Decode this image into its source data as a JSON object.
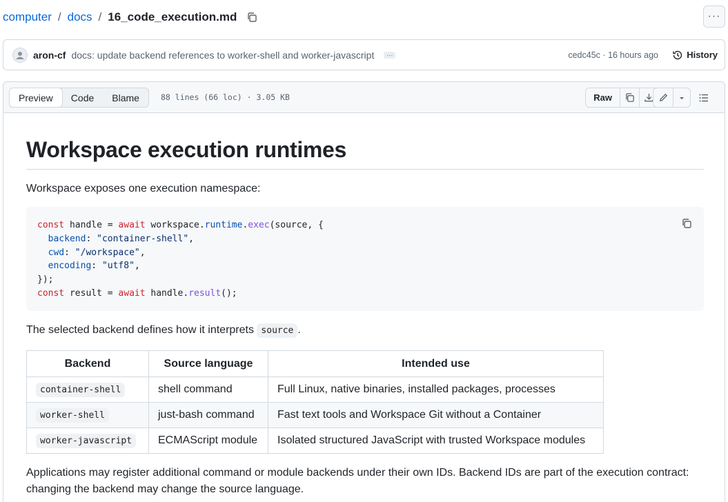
{
  "breadcrumb": {
    "repo": "computer",
    "folder": "docs",
    "file": "16_code_execution.md",
    "separator": "/"
  },
  "more_button": {
    "label": "···",
    "icon": "kebab-horizontal-icon"
  },
  "commit": {
    "author": "aron-cf",
    "message": "docs: update backend references to worker-shell and worker-javascript",
    "sha_time": "cedc45c · 16 hours ago",
    "history_label": "History"
  },
  "file_header": {
    "tabs": [
      "Preview",
      "Code",
      "Blame"
    ],
    "active_tab": "Preview",
    "meta": "88 lines (66 loc) · 3.05 KB",
    "raw_label": "Raw"
  },
  "content": {
    "title": "Workspace execution runtimes",
    "intro": "Workspace exposes one execution namespace:",
    "code_lines": [
      "const handle = await workspace.runtime.exec(source, {",
      "  backend: \"container-shell\",",
      "  cwd: \"/workspace\",",
      "  encoding: \"utf8\",",
      "});",
      "const result = await handle.result();"
    ],
    "selected_text_before": "The selected backend defines how it interprets ",
    "selected_code": "source",
    "selected_text_after": ".",
    "table": {
      "headers": [
        "Backend",
        "Source language",
        "Intended use"
      ],
      "rows": [
        [
          "container-shell",
          "shell command",
          "Full Linux, native binaries, installed packages, processes"
        ],
        [
          "worker-shell",
          "just-bash command",
          "Fast text tools and Workspace Git without a Container"
        ],
        [
          "worker-javascript",
          "ECMAScript module",
          "Isolated structured JavaScript with trusted Workspace modules"
        ]
      ]
    },
    "closing_line1": "Applications may register additional command or module backends under their own IDs. Backend IDs are part of the execution contract:",
    "closing_line2": "changing the backend may change the source language."
  },
  "colors": {
    "link": "#0969da",
    "border": "#d1d9e0",
    "muted": "#59636e",
    "keyword": "#cf222e",
    "function": "#8250df",
    "property": "#0550ae",
    "string": "#0a3069"
  }
}
